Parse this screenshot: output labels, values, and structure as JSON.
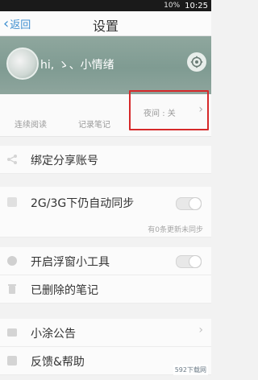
{
  "status_bar": {
    "left_text": "",
    "signal_text": "10%",
    "time": "10:25"
  },
  "header": {
    "back_label": "返回",
    "title": "设置"
  },
  "profile": {
    "username": "hi, ゝ、小情绪"
  },
  "quick_actions": [
    {
      "label": "连续阅读"
    },
    {
      "label": "记录笔记"
    }
  ],
  "night_mode": {
    "label": "夜间",
    "value": "关"
  },
  "settings": {
    "bind_share": "绑定分享账号",
    "auto_sync": "2G/3G下仍自动同步",
    "sync_note": "有0条更新未同步",
    "float_window": "开启浮窗小工具",
    "deleted_notes": "已删除的笔记",
    "announcement": "小涂公告",
    "feedback": "反馈&帮助"
  },
  "colors": {
    "accent": "#3f8fd0",
    "highlight_border": "#d6292a"
  },
  "icons": {
    "gear": "gear-icon",
    "share": "share-icon",
    "sync": "sync-icon",
    "float": "float-window-icon",
    "trash": "trash-icon",
    "announce": "announcement-icon",
    "feedback": "feedback-icon"
  },
  "watermark": "592下载网"
}
